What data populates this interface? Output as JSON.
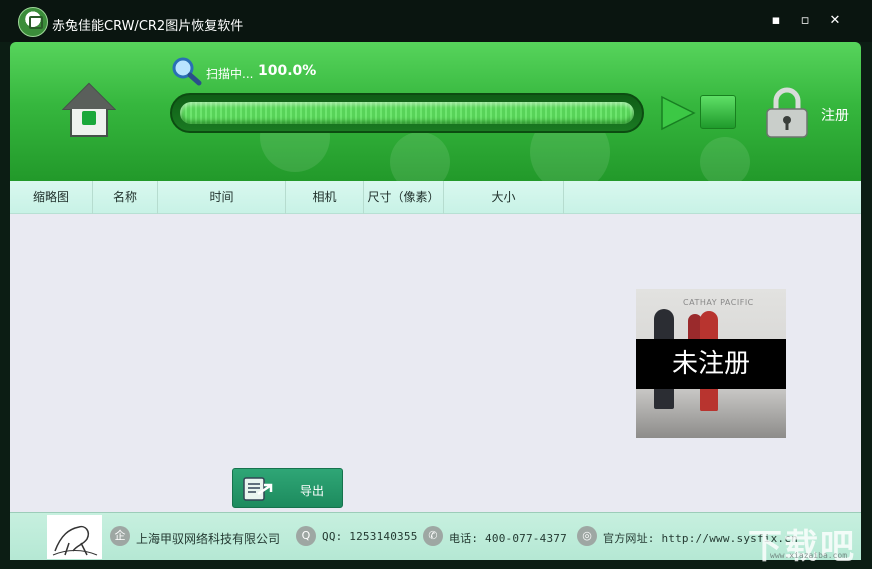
{
  "window": {
    "title": "赤兔佳能CRW/CR2图片恢复软件"
  },
  "titlebar": {
    "minimize": "▪",
    "maximize": "▫",
    "close": "✕"
  },
  "scan": {
    "status": "扫描中...",
    "percent": "100.0%",
    "progress": 1.0
  },
  "header": {
    "register_label": "注册"
  },
  "columns": [
    "缩略图",
    "名称",
    "时间",
    "相机",
    "尺寸（像素）",
    "大小"
  ],
  "thumbnail": {
    "brand": "CATHAY PACIFIC",
    "overlay": "未注册"
  },
  "export": {
    "label": "导出"
  },
  "footer": {
    "company": "上海甲驭网络科技有限公司",
    "qq": "QQ: 1253140355",
    "phone": "电话: 400-077-4377",
    "website": "官方网址: http://www.sysfix.cn"
  },
  "watermark": {
    "text": "下载吧",
    "sub": "www.xiazaiba.com"
  },
  "colors": {
    "header_green": "#36b73e",
    "accent_teal": "#1d8b5e",
    "list_bg": "#e9eaf2"
  }
}
